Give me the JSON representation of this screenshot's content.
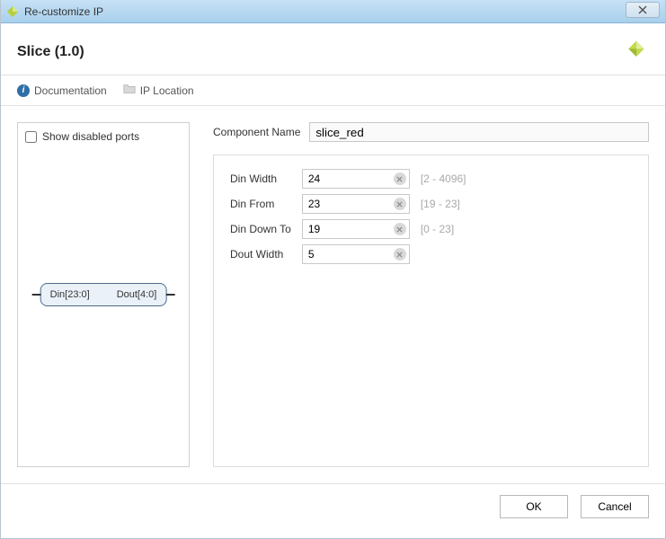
{
  "window": {
    "title": "Re-customize IP"
  },
  "header": {
    "title": "Slice (1.0)"
  },
  "linkbar": {
    "doc": "Documentation",
    "ip_loc": "IP Location"
  },
  "left_panel": {
    "checkbox_label": "Show disabled ports",
    "block": {
      "din": "Din[23:0]",
      "dout": "Dout[4:0]"
    }
  },
  "component_name": {
    "label": "Component Name",
    "value": "slice_red"
  },
  "params": {
    "rows": [
      {
        "label": "Din Width",
        "value": "24",
        "hint": "[2 - 4096]"
      },
      {
        "label": "Din From",
        "value": "23",
        "hint": "[19 - 23]"
      },
      {
        "label": "Din Down To",
        "value": "19",
        "hint": "[0 - 23]"
      },
      {
        "label": "Dout Width",
        "value": "5",
        "hint": ""
      }
    ]
  },
  "footer": {
    "ok": "OK",
    "cancel": "Cancel"
  }
}
